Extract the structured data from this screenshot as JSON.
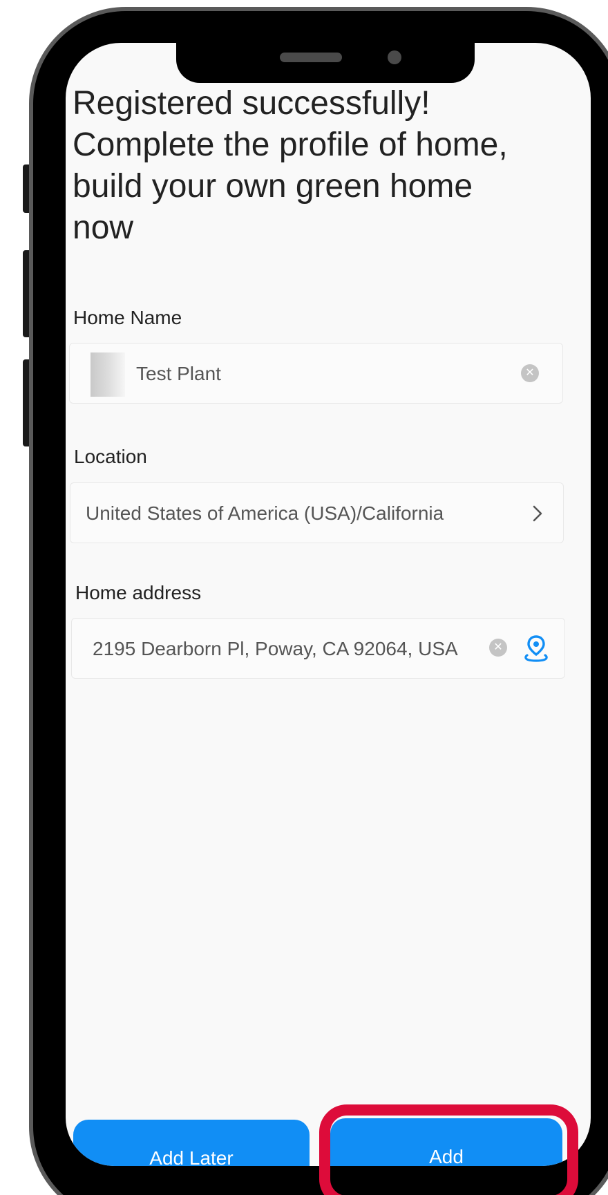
{
  "headline": {
    "line1": "Registered successfully!",
    "line2": "Complete the profile of home,",
    "line3": "build your own green home",
    "line4": "now"
  },
  "form": {
    "home_name": {
      "label": "Home Name",
      "value": "Test Plant",
      "clear_icon": "clear-circle-icon"
    },
    "location": {
      "label": "Location",
      "value": "United States of America (USA)/California",
      "action_icon": "chevron-right-icon"
    },
    "home_address": {
      "label": "Home address",
      "value": "2195 Dearborn Pl, Poway, CA 92064, USA",
      "clear_icon": "clear-circle-icon",
      "action_icon": "map-pin-icon"
    }
  },
  "actions": {
    "later_label": "Add Later",
    "add_label": "Add"
  },
  "colors": {
    "primary": "#118ef5",
    "highlight": "#dd0c3a",
    "screen_bg": "#f9f9f9",
    "text_primary": "#222222",
    "text_secondary": "#555555"
  }
}
